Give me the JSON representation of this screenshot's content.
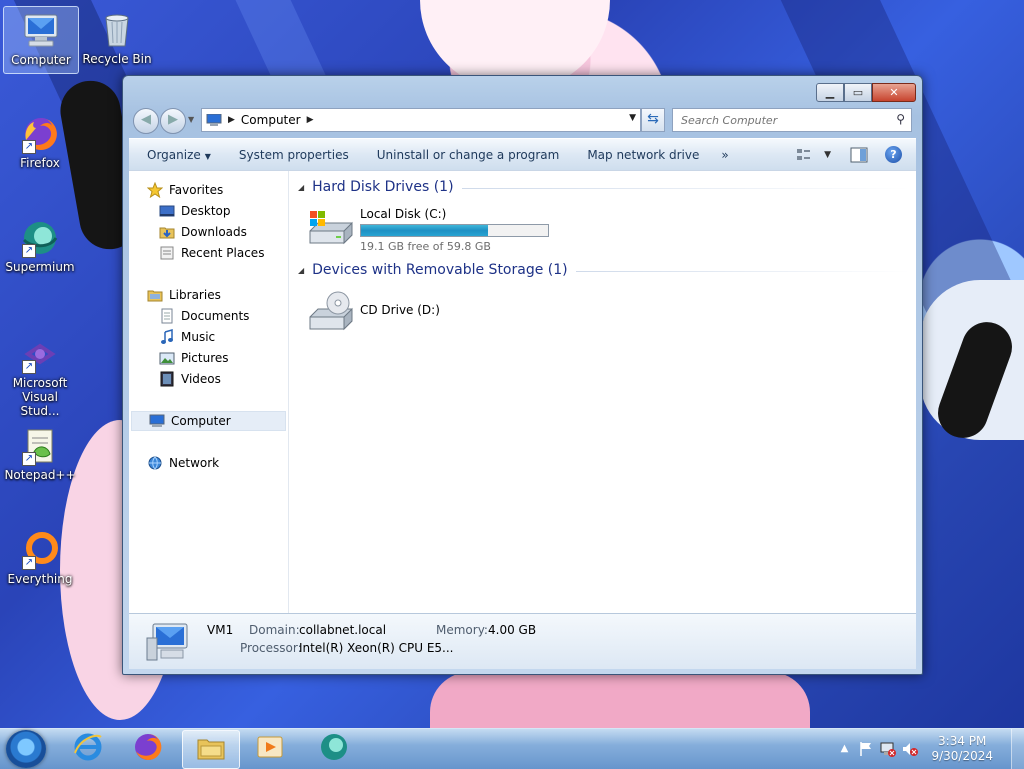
{
  "desktop": {
    "icons": [
      {
        "label": "Computer",
        "icon": "computer-icon"
      },
      {
        "label": "Recycle Bin",
        "icon": "recycle-bin-icon"
      },
      {
        "label": "Firefox",
        "icon": "firefox-icon"
      },
      {
        "label": "Supermium",
        "icon": "supermium-icon"
      },
      {
        "label": "Microsoft Visual Stud...",
        "icon": "visual-studio-icon"
      },
      {
        "label": "Notepad++",
        "icon": "notepad-plus-plus-icon"
      },
      {
        "label": "Everything",
        "icon": "everything-icon"
      }
    ]
  },
  "window": {
    "address": {
      "crumb": "Computer"
    },
    "search": {
      "placeholder": "Search Computer"
    },
    "toolbar": {
      "organize": "Organize",
      "system_properties": "System properties",
      "uninstall": "Uninstall or change a program",
      "map_drive": "Map network drive",
      "more": "»"
    },
    "nav": {
      "favorites": "Favorites",
      "desktop": "Desktop",
      "downloads": "Downloads",
      "recent_places": "Recent Places",
      "libraries": "Libraries",
      "documents": "Documents",
      "music": "Music",
      "pictures": "Pictures",
      "videos": "Videos",
      "computer": "Computer",
      "network": "Network"
    },
    "groups": {
      "hdd": "Hard Disk Drives (1)",
      "removable": "Devices with Removable Storage (1)"
    },
    "drives": {
      "c": {
        "name": "Local Disk (C:)",
        "free_text": "19.1 GB free of 59.8 GB",
        "used_fraction": 0.68
      },
      "d": {
        "name": "CD Drive (D:)"
      }
    },
    "details": {
      "name": "VM1",
      "domain_label": "Domain:",
      "domain": "collabnet.local",
      "memory_label": "Memory:",
      "memory": "4.00 GB",
      "processor_label": "Processor:",
      "processor": "Intel(R) Xeon(R) CPU E5..."
    }
  },
  "taskbar": {
    "apps": [
      "internet-explorer-icon",
      "firefox-icon",
      "windows-explorer-icon",
      "media-player-icon",
      "supermium-icon"
    ],
    "time": "3:34 PM",
    "date": "9/30/2024"
  },
  "colors": {
    "group_header": "#1e3287",
    "toolbar_text": "#1e395b",
    "drive_bar": "#27a4d2"
  }
}
